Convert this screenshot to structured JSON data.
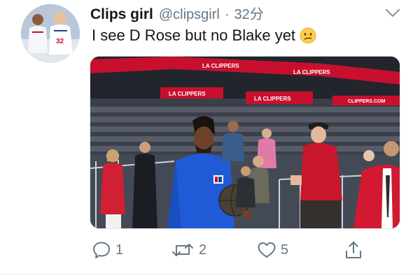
{
  "tweet": {
    "display_name": "Clips girl",
    "handle": "@clipsgirl",
    "separator": "·",
    "time": "32分",
    "text": "I see D Rose but no Blake yet",
    "emoji": "confused-face-icon"
  },
  "photo": {
    "banners": [
      "LA CLIPPERS",
      "LA CLIPPERS",
      "LA CLIPPERS",
      "LA CLIPPERS",
      "CLIPPERS.COM"
    ]
  },
  "actions": {
    "reply_count": "1",
    "retweet_count": "2",
    "like_count": "5"
  },
  "colors": {
    "text": "#14171a",
    "muted": "#657786",
    "clippers_red": "#c8102e",
    "jersey_blue": "#1f5bd6"
  }
}
